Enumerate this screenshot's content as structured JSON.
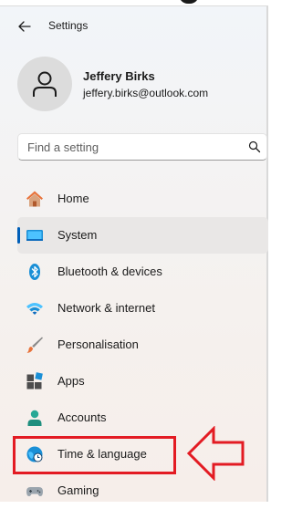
{
  "window": {
    "title": "Settings"
  },
  "profile": {
    "name": "Jeffery Birks",
    "email": "jeffery.birks@outlook.com"
  },
  "search": {
    "placeholder": "Find a setting",
    "value": ""
  },
  "nav": {
    "items": [
      {
        "label": "Home",
        "icon": "home-icon",
        "selected": false
      },
      {
        "label": "System",
        "icon": "system-icon",
        "selected": true
      },
      {
        "label": "Bluetooth & devices",
        "icon": "bluetooth-icon",
        "selected": false
      },
      {
        "label": "Network & internet",
        "icon": "wifi-icon",
        "selected": false
      },
      {
        "label": "Personalisation",
        "icon": "brush-icon",
        "selected": false
      },
      {
        "label": "Apps",
        "icon": "apps-icon",
        "selected": false
      },
      {
        "label": "Accounts",
        "icon": "accounts-icon",
        "selected": false
      },
      {
        "label": "Time & language",
        "icon": "time-language-icon",
        "selected": false
      },
      {
        "label": "Gaming",
        "icon": "gamepad-icon",
        "selected": false
      }
    ]
  },
  "annotation": {
    "highlight_color": "#e31b23",
    "target": "Time & language"
  },
  "colors": {
    "accent": "#005fb8",
    "selected_bg": "#e9e7e6"
  }
}
